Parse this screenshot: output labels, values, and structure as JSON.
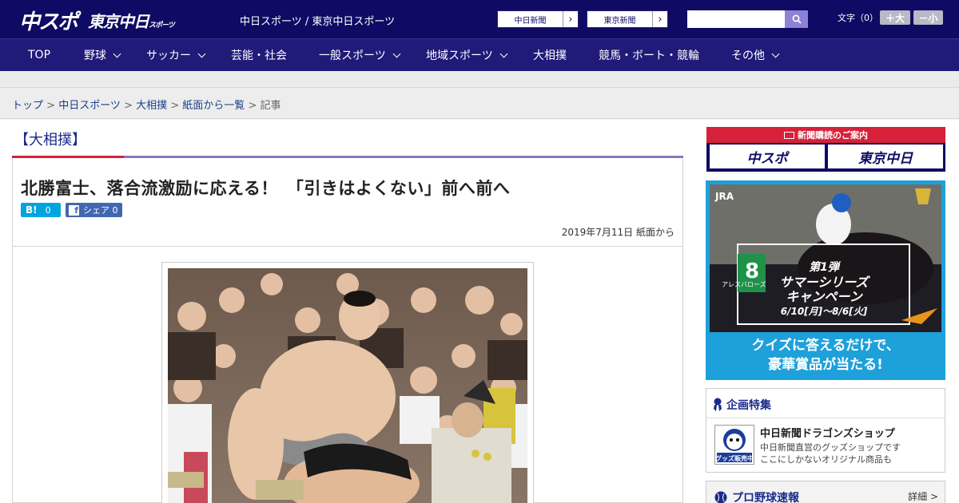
{
  "header": {
    "logo_chuspo": "中スポ",
    "logo_tokyo": "東京中日",
    "logo_tokyo_small": "スポーツ",
    "site_link": "中日スポーツ / 東京中日スポーツ",
    "ext_links": [
      {
        "label": "中日新聞",
        "arrow": "›"
      },
      {
        "label": "東京新聞",
        "arrow": "›"
      }
    ],
    "search_placeholder": "",
    "font_size_label": "文字（0）",
    "font_larger": "＋大",
    "font_smaller": "－小"
  },
  "nav": {
    "items": [
      {
        "label": "TOP",
        "has_menu": false
      },
      {
        "label": "野球",
        "has_menu": true
      },
      {
        "label": "サッカー",
        "has_menu": true
      },
      {
        "label": "芸能・社会",
        "has_menu": false
      },
      {
        "label": "一般スポーツ",
        "has_menu": true
      },
      {
        "label": "地域スポーツ",
        "has_menu": true
      },
      {
        "label": "大相撲",
        "has_menu": false
      },
      {
        "label": "競馬・ボート・競輪",
        "has_menu": false
      },
      {
        "label": "その他",
        "has_menu": true
      }
    ]
  },
  "breadcrumb": {
    "items": [
      "トップ",
      "中日スポーツ",
      "大相撲",
      "紙面から一覧"
    ],
    "current": "記事",
    "separator": " > "
  },
  "article": {
    "category": "【大相撲】",
    "headline": "北勝富士、落合流激励に応える！　「引きはよくない」前へ前へ",
    "hatena_count": "0",
    "hatena_label": "B!",
    "fb_label": "シェア",
    "fb_count": "0",
    "dateline": "2019年7月11日 紙面から"
  },
  "sidebar": {
    "subscribe_title": "新聞購読のご案内",
    "subscribe_buttons": [
      "中スポ",
      "東京中日"
    ],
    "jra_ad": {
      "brand": "JRA",
      "number": "8",
      "series": "第1弾",
      "title_line1": "サマーシリーズ",
      "title_line2": "キャンペーン",
      "dates": "6/10[月]～8/6[火]",
      "horse_name": "アレスバローズ",
      "copy_line1": "クイズに答えるだけで、",
      "copy_line2": "豪華賞品が当たる!"
    },
    "kikaku": {
      "title": "企画特集",
      "shop_title": "中日新聞ドラゴンズショップ",
      "shop_desc1": "中日新聞直営のグッズショップです",
      "shop_desc2": "ここにしかないオリジナル商品も",
      "shop_badge": "グッズ販売中"
    },
    "baseball": {
      "title": "プロ野球速報",
      "more": "詳細 >"
    }
  },
  "colors": {
    "header_bg": "#0f0b64",
    "nav_bg": "#201a78",
    "accent_red": "#d7203a",
    "accent_purple": "#8478c4",
    "hatena_blue": "#00a4de",
    "facebook_blue": "#4267b2"
  }
}
